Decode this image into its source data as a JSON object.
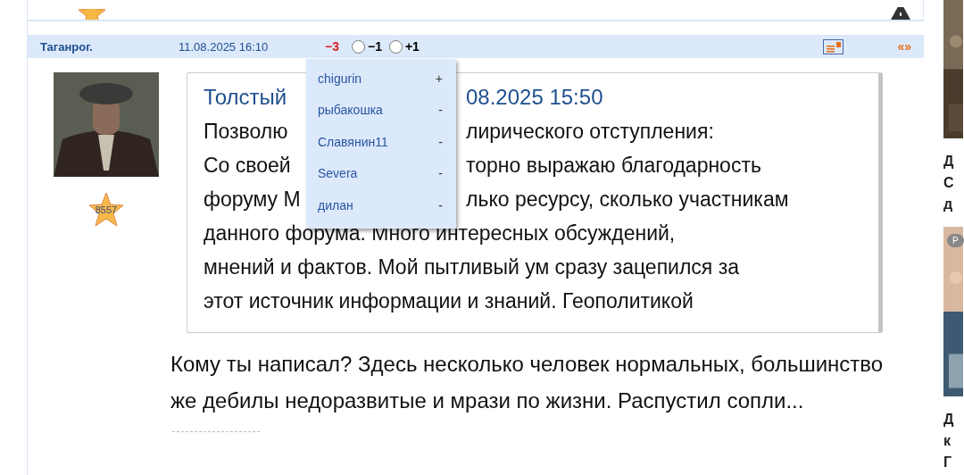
{
  "post": {
    "author": "Таганрог.",
    "date": "11.08.2025 16:10",
    "rating": "−3",
    "votes": [
      {
        "label": "−1",
        "selected": false
      },
      {
        "label": "+1",
        "selected": false
      }
    ],
    "nav": "«»",
    "author_rating": "8557",
    "quote": {
      "title": {
        "left": "Толстый",
        "right": "08.2025 15:50"
      },
      "lines": [
        {
          "left": "Позволю",
          "right": "лирического отступления:"
        },
        {
          "left": "Со своей",
          "right": "торно выражаю благодарность"
        },
        {
          "left": "форуму М",
          "right": "лько ресурсу, сколько участникам"
        },
        {
          "text": "данного форума. Много интересных обсуждений,"
        },
        {
          "text": "мнений и фактов. Мой пытливый ум сразу зацепился за"
        },
        {
          "text": "этот источник информации и знаний. Геополитикой"
        }
      ]
    },
    "text": "Кому ты написал? Здесь несколько человек нормальных, большинство же дебилы недоразвитые и мрази по жизни. Распустил сопли..."
  },
  "voters_popup": [
    {
      "name": "chigurin",
      "vote": "+"
    },
    {
      "name": "рыбакошка",
      "vote": "-"
    },
    {
      "name": "Славянин11",
      "vote": "-"
    },
    {
      "name": "Severa",
      "vote": "-"
    },
    {
      "name": "дилан",
      "vote": "-"
    }
  ],
  "sidebar": [
    {
      "lines": [
        "Д",
        "С",
        "д"
      ]
    },
    {
      "badge": "Р",
      "lines": [
        "Д",
        "к",
        "Г"
      ]
    }
  ]
}
